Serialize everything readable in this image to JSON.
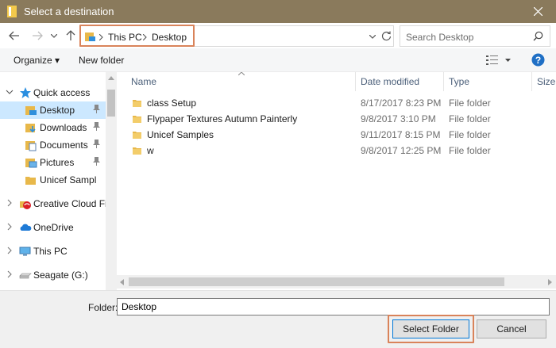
{
  "window": {
    "title": "Select a destination",
    "title_bar_color": "#8a7a5c",
    "close_icon": "close-icon"
  },
  "nav": {
    "back_icon": "arrow-left-icon",
    "forward_icon": "arrow-right-icon",
    "recent_icon": "chevron-down-icon",
    "up_icon": "arrow-up-icon",
    "address_crumbs": [
      "This PC",
      "Desktop"
    ],
    "refresh_icon": "refresh-icon",
    "search_placeholder": "Search Desktop"
  },
  "toolbar": {
    "organize_label": "Organize ▾",
    "new_folder_label": "New folder"
  },
  "sidebar": {
    "items": [
      {
        "label": "Quick access",
        "icon": "star-icon"
      },
      {
        "label": "Desktop",
        "icon": "desktop-folder-icon",
        "pinned": true,
        "selected": true
      },
      {
        "label": "Downloads",
        "icon": "downloads-folder-icon",
        "pinned": true
      },
      {
        "label": "Documents",
        "icon": "documents-folder-icon",
        "pinned": true
      },
      {
        "label": "Pictures",
        "icon": "pictures-folder-icon",
        "pinned": true
      },
      {
        "label": "Unicef Sampl",
        "icon": "folder-icon"
      },
      {
        "label": "Creative Cloud File",
        "icon": "creative-cloud-icon"
      },
      {
        "label": "OneDrive",
        "icon": "cloud-icon"
      },
      {
        "label": "This PC",
        "icon": "computer-icon"
      },
      {
        "label": "Seagate (G:)",
        "icon": "drive-icon"
      }
    ]
  },
  "file_list": {
    "columns": [
      "Name",
      "Date modified",
      "Type",
      "Size"
    ],
    "rows": [
      {
        "name": "class Setup",
        "date": "8/17/2017 8:23 PM",
        "type": "File folder"
      },
      {
        "name": "Flypaper Textures Autumn Painterly",
        "date": "9/8/2017 3:10 PM",
        "type": "File folder"
      },
      {
        "name": "Unicef Samples",
        "date": "9/11/2017 8:15 PM",
        "type": "File folder"
      },
      {
        "name": "w",
        "date": "9/8/2017 12:25 PM",
        "type": "File folder"
      }
    ]
  },
  "footer": {
    "folder_label": "Folder:",
    "folder_value": "Desktop",
    "select_button": "Select Folder",
    "cancel_button": "Cancel"
  },
  "colors": {
    "highlight": "#d9835a",
    "selected_bg": "#cce8ff",
    "folder_yellow": "#e8b84a"
  }
}
